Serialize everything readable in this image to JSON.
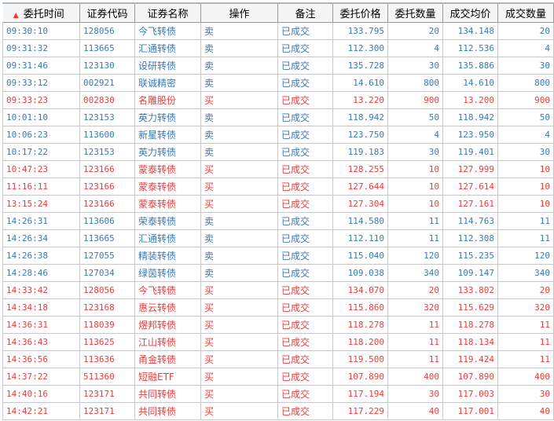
{
  "colors": {
    "sell": "#3b79b6",
    "buy": "#ee3b3b"
  },
  "headers": [
    "委托时间",
    "证券代码",
    "证券名称",
    "操作",
    "备注",
    "委托价格",
    "委托数量",
    "成交均价",
    "成交数量"
  ],
  "sort_icon": "sort-ascending-icon",
  "rows": [
    [
      "09:30:10",
      "128056",
      "今飞转债",
      "卖",
      "已成交",
      "133.795",
      "20",
      "134.148",
      "20"
    ],
    [
      "09:31:32",
      "113665",
      "汇通转债",
      "卖",
      "已成交",
      "112.300",
      "4",
      "112.536",
      "4"
    ],
    [
      "09:31:46",
      "123130",
      "设研转债",
      "卖",
      "已成交",
      "135.728",
      "30",
      "135.886",
      "30"
    ],
    [
      "09:33:12",
      "002921",
      "联诚精密",
      "卖",
      "已成交",
      "14.610",
      "800",
      "14.610",
      "800"
    ],
    [
      "09:33:23",
      "002830",
      "名雕股份",
      "买",
      "已成交",
      "13.220",
      "900",
      "13.200",
      "900"
    ],
    [
      "10:01:10",
      "123153",
      "英力转债",
      "卖",
      "已成交",
      "118.942",
      "50",
      "118.942",
      "50"
    ],
    [
      "10:06:23",
      "113600",
      "新星转债",
      "卖",
      "已成交",
      "123.750",
      "4",
      "123.950",
      "4"
    ],
    [
      "10:17:22",
      "123153",
      "英力转债",
      "卖",
      "已成交",
      "119.183",
      "30",
      "119.401",
      "30"
    ],
    [
      "10:47:23",
      "123166",
      "蒙泰转债",
      "买",
      "已成交",
      "128.255",
      "10",
      "127.999",
      "10"
    ],
    [
      "11:16:11",
      "123166",
      "蒙泰转债",
      "买",
      "已成交",
      "127.644",
      "10",
      "127.614",
      "10"
    ],
    [
      "13:15:24",
      "123166",
      "蒙泰转债",
      "买",
      "已成交",
      "127.304",
      "10",
      "127.161",
      "10"
    ],
    [
      "14:26:31",
      "113606",
      "荣泰转债",
      "卖",
      "已成交",
      "114.580",
      "11",
      "114.763",
      "11"
    ],
    [
      "14:26:34",
      "113665",
      "汇通转债",
      "卖",
      "已成交",
      "112.110",
      "11",
      "112.308",
      "11"
    ],
    [
      "14:26:38",
      "127055",
      "精装转债",
      "卖",
      "已成交",
      "115.040",
      "120",
      "115.235",
      "120"
    ],
    [
      "14:28:46",
      "127034",
      "绿茵转债",
      "卖",
      "已成交",
      "109.038",
      "340",
      "109.147",
      "340"
    ],
    [
      "14:33:42",
      "128056",
      "今飞转债",
      "买",
      "已成交",
      "134.070",
      "20",
      "133.802",
      "20"
    ],
    [
      "14:34:18",
      "123168",
      "惠云转债",
      "买",
      "已成交",
      "115.860",
      "320",
      "115.629",
      "320"
    ],
    [
      "14:36:31",
      "118039",
      "煜邦转债",
      "买",
      "已成交",
      "118.278",
      "11",
      "118.278",
      "11"
    ],
    [
      "14:36:43",
      "113625",
      "江山转债",
      "买",
      "已成交",
      "118.200",
      "11",
      "118.134",
      "11"
    ],
    [
      "14:36:56",
      "113636",
      "甬金转债",
      "买",
      "已成交",
      "119.500",
      "11",
      "119.424",
      "11"
    ],
    [
      "14:37:22",
      "511360",
      "短融ETF",
      "买",
      "已成交",
      "107.890",
      "400",
      "107.890",
      "400"
    ],
    [
      "14:40:16",
      "123171",
      "共同转债",
      "买",
      "已成交",
      "117.194",
      "30",
      "117.003",
      "30"
    ],
    [
      "14:42:21",
      "123171",
      "共同转债",
      "买",
      "已成交",
      "117.229",
      "40",
      "117.001",
      "40"
    ]
  ]
}
